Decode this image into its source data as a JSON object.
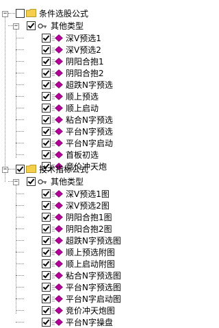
{
  "tree": {
    "groups": [
      {
        "label": "条件选股公式",
        "subgroup": {
          "label": "其他类型",
          "items": [
            "深V预选1",
            "深V预选2",
            "阴阳合抱1",
            "阴阳合抱2",
            "超跌N字预选",
            "顺上预选",
            "顺上启动",
            "粘合N字预选",
            "平台N字预选",
            "平台N字启动",
            "首板初选",
            "竞价冲天炮"
          ]
        }
      },
      {
        "label": "技术指标公式",
        "subgroup": {
          "label": "其他类型",
          "items": [
            "深V预选1图",
            "深V预选2图",
            "阴阳合抱1图",
            "阴阳合抱2图",
            "超跌N字预选图",
            "顺上预选附图",
            "顺上启动附图",
            "粘合N字预选图",
            "平台N字预选图",
            "平台N字启动图",
            "竞价冲天炮图",
            "平台N字操盘"
          ]
        }
      }
    ]
  },
  "colors": {
    "diamond": "#b40099",
    "folder": "#f5cf4c"
  }
}
